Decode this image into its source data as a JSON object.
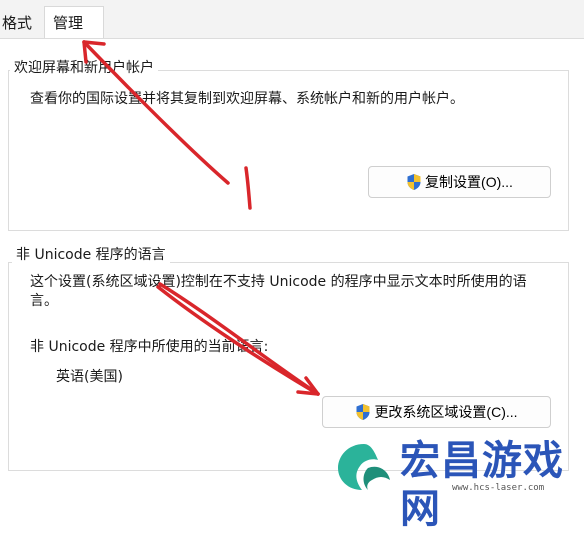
{
  "tabs": [
    {
      "label": "格式"
    },
    {
      "label": "管理"
    }
  ],
  "welcome": {
    "title": "欢迎屏幕和新用户帐户",
    "description": "查看你的国际设置并将其复制到欢迎屏幕、系统帐户和新的用户帐户。",
    "copy_button": "复制设置(O)..."
  },
  "unicode": {
    "title": "非 Unicode 程序的语言",
    "description": "这个设置(系统区域设置)控制在不支持 Unicode 的程序中显示文本时所使用的语言。",
    "current_label": "非 Unicode 程序中所使用的当前语言:",
    "current_value": "英语(美国)",
    "change_button": "更改系统区域设置(C)..."
  },
  "annotation": {
    "marker": "1",
    "color": "#d9262b"
  },
  "watermark": {
    "name": "宏昌游戏网",
    "url": "www.hcs-laser.com"
  },
  "icons": {
    "uac_shield": "shield-icon"
  }
}
